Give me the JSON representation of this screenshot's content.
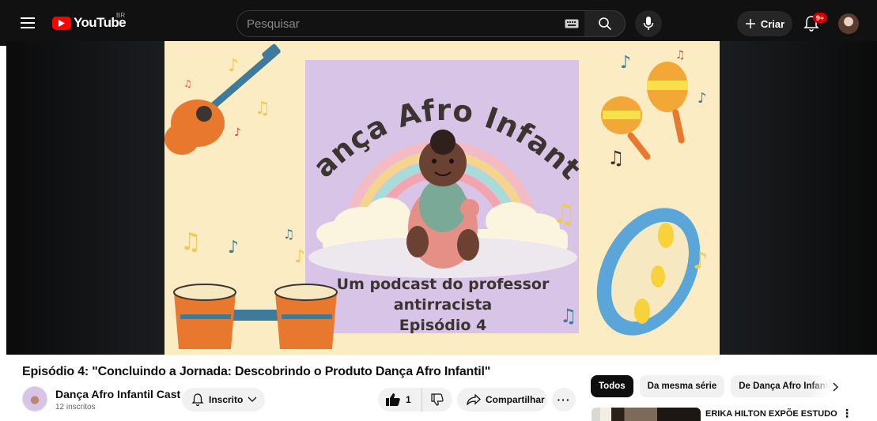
{
  "topbar": {
    "logo_text": "YouTube",
    "region": "BR",
    "search_placeholder": "Pesquisar",
    "create_label": "Criar",
    "notification_count": "9+"
  },
  "video": {
    "thumbnail": {
      "title_text": "Dança Afro Infantil",
      "subtitle_line1": "Um podcast do professor",
      "subtitle_line2": "antirracista",
      "episode": "Episódio 4"
    },
    "title": "Episódio 4: \"Concluindo a Jornada: Descobrindo o Produto Dança Afro Infantil\"",
    "channel_name": "Dança Afro Infantil Cast",
    "subscribers": "12 inscritos",
    "subscribe_label": "Inscrito",
    "like_count": "1",
    "share_label": "Compartilhar"
  },
  "sidebar": {
    "chips": [
      "Todos",
      "Da mesma série",
      "De Dança Afro Infantil"
    ],
    "recommendation_title": "ERIKA HILTON EXPÕE ESTUDO"
  },
  "colors": {
    "topbar_bg": "#111111",
    "youtube_red": "#ff0000",
    "thumb_bg": "#fbecc4",
    "thumb_square": "#d8c4e6",
    "thumb_text": "#3b3430"
  }
}
